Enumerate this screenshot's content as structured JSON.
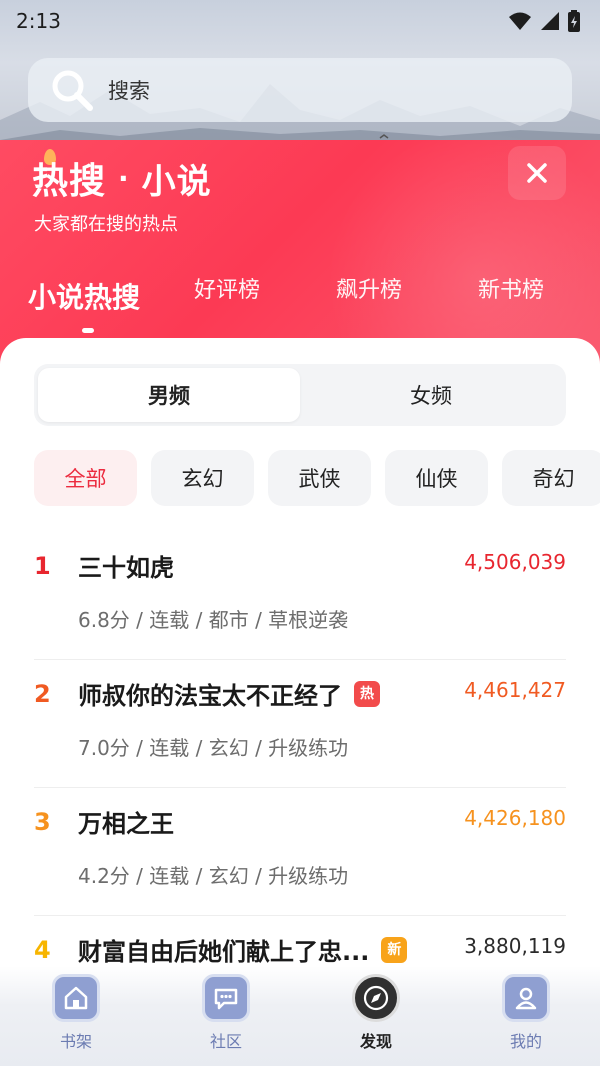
{
  "status_bar": {
    "time": "2:13"
  },
  "search": {
    "placeholder": "搜索"
  },
  "header": {
    "title_main": "热搜",
    "title_dot": "·",
    "title_sub": "小说",
    "subtitle": "大家都在搜的热点",
    "tabs": [
      "小说热搜",
      "好评榜",
      "飙升榜",
      "新书榜"
    ],
    "active_tab": 0
  },
  "gender_tabs": [
    "男频",
    "女频"
  ],
  "active_gender": 0,
  "categories": [
    "全部",
    "玄幻",
    "武侠",
    "仙侠",
    "奇幻"
  ],
  "active_category": 0,
  "books": [
    {
      "rank": "1",
      "title": "三十如虎",
      "meta": "6.8分 / 连载 / 都市 / 草根逆袭",
      "count": "4,506,039",
      "badge": ""
    },
    {
      "rank": "2",
      "title": "师叔你的法宝太不正经了",
      "meta": "7.0分 / 连载 / 玄幻 / 升级练功",
      "count": "4,461,427",
      "badge": "热"
    },
    {
      "rank": "3",
      "title": "万相之王",
      "meta": "4.2分 / 连载 / 玄幻 / 升级练功",
      "count": "4,426,180",
      "badge": ""
    },
    {
      "rank": "4",
      "title": "财富自由后她们献上了忠...",
      "meta": "",
      "count": "3,880,119",
      "badge": "新"
    }
  ],
  "colors": {
    "rank_1": "#e8262f",
    "rank_2": "#f05a22",
    "rank_3": "#f6921e",
    "rank_4": "#f7b500",
    "badge_hot": "#f24b4b",
    "badge_new": "#f8a31a",
    "accent": "#fc3a54"
  },
  "bottom_nav": [
    {
      "label": "书架",
      "icon": "home-icon"
    },
    {
      "label": "社区",
      "icon": "chat-icon"
    },
    {
      "label": "发现",
      "icon": "compass-icon"
    },
    {
      "label": "我的",
      "icon": "user-icon"
    }
  ],
  "active_nav": 2
}
